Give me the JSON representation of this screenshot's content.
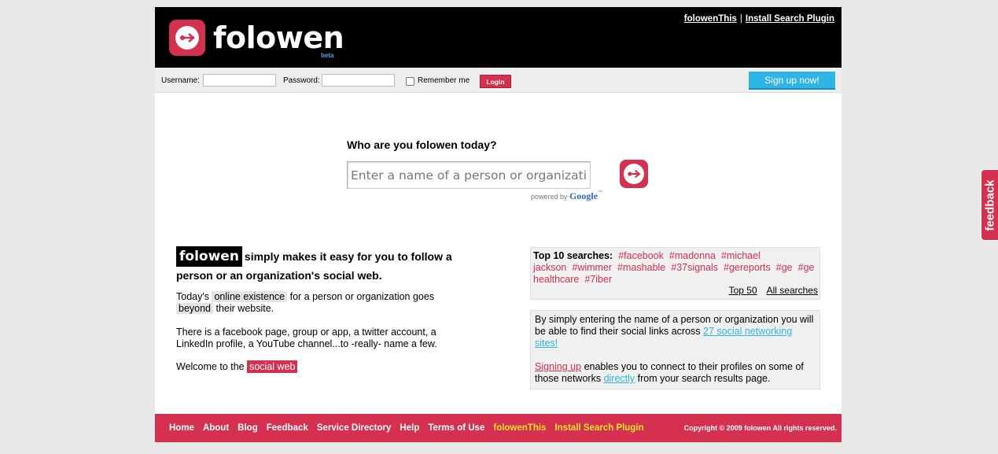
{
  "header": {
    "logo_text": "folowen",
    "beta": "beta",
    "links": [
      "folowenThis",
      "Install Search Plugin"
    ],
    "separator": "|"
  },
  "login": {
    "username_label": "Username:",
    "password_label": "Password:",
    "username_value": "",
    "password_value": "",
    "remember_label": "Remember me",
    "remember_checked": false,
    "login_button": "Login",
    "signup_button": "Sign up now!"
  },
  "search": {
    "question": "Who are you folowen today?",
    "placeholder": "Enter a name of a person or organization.",
    "powered_by": "powered by",
    "google": "Google",
    "tm": "™"
  },
  "intro": {
    "logo": "folowen",
    "headline": "simply makes it easy for you to follow a person or an organization's social web.",
    "p1_a": "Today's",
    "p1_hl1": "online existence",
    "p1_b": "for a person or organization goes",
    "p1_hl2": "beyond",
    "p1_c": "their website.",
    "p2": "There is a facebook page, group or app, a twitter account, a LinkedIn profile, a YouTube channel...to -really- name a few.",
    "p3_a": "Welcome to the",
    "p3_hl": "social web"
  },
  "top10": {
    "label": "Top 10 searches:",
    "tags": [
      "#facebook",
      "#madonna",
      "#michael jackson",
      "#wimmer",
      "#mashable",
      "#37signals",
      "#gereports",
      "#ge",
      "#ge healthcare",
      "#7iber"
    ],
    "top50": "Top 50",
    "all": "All searches"
  },
  "about": {
    "t1": "By simply entering the name of a person or organization you will be able to find their social links across",
    "link1": "27 social networking sites!",
    "link2": "Signing up",
    "t2": "enables you to connect to their profiles on some of those networks",
    "link3": "directly",
    "t3": "from your search results page."
  },
  "footer": {
    "nav": [
      "Home",
      "About",
      "Blog",
      "Feedback",
      "Service Directory",
      "Help",
      "Terms of Use"
    ],
    "highlight": [
      "folowenThis",
      "Install Search Plugin"
    ],
    "copyright": "Copyright © 2009 folowen   All rights reserved."
  },
  "feedback_tab": "feedback",
  "colors": {
    "brand_red": "#d5304f",
    "signup_blue": "#2fb4e6",
    "footer_yellow": "#f4e42a"
  },
  "icons": {
    "logo": "arrow-right-circle-icon",
    "search_go": "arrow-right-circle-icon"
  }
}
